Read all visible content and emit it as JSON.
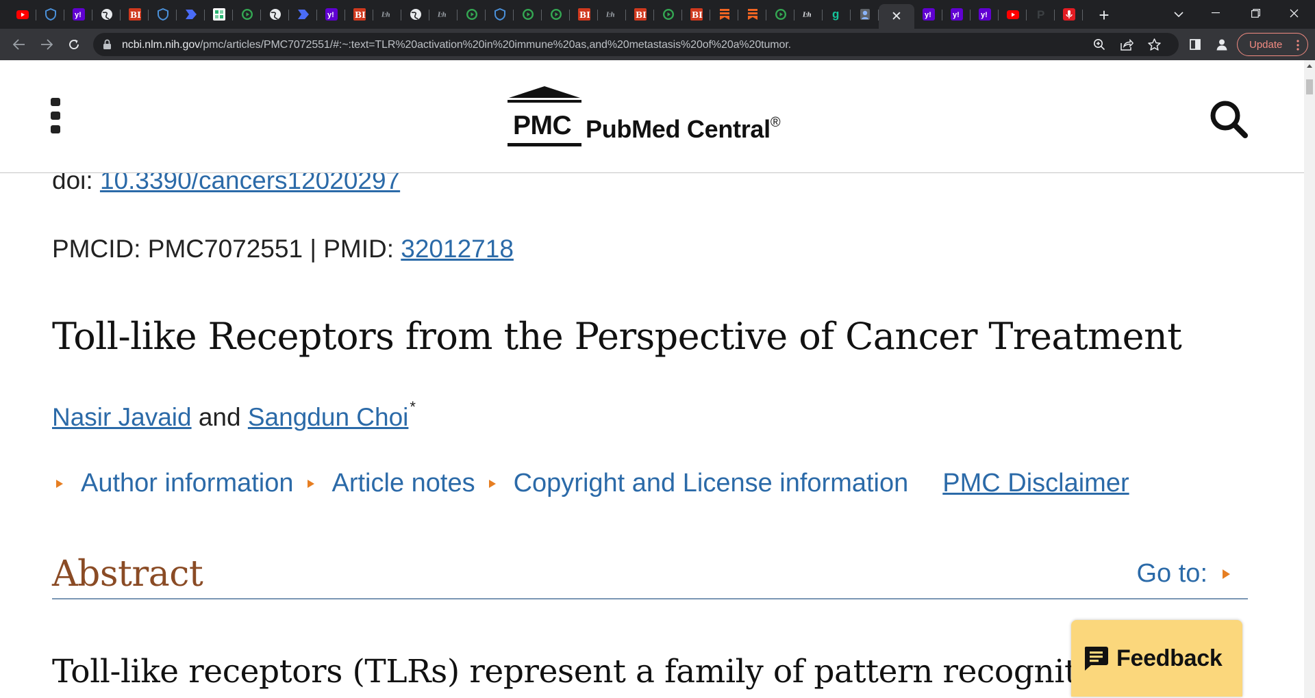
{
  "browser": {
    "tabs": [
      {
        "icon": "youtube-icon",
        "color": "#ff0000"
      },
      {
        "icon": "shield-icon",
        "color": "#4a90d9"
      },
      {
        "icon": "yahoo-icon",
        "color": "#6001d2"
      },
      {
        "icon": "globe-icon",
        "color": "#e8eaed"
      },
      {
        "icon": "business-insider-icon",
        "color": "#d0391e"
      },
      {
        "icon": "shield-icon",
        "color": "#4a90d9"
      },
      {
        "icon": "arrow-tag-icon",
        "color": "#4a6cf7"
      },
      {
        "icon": "puzzle-icon",
        "color": "#2bb673"
      },
      {
        "icon": "play-circle-icon",
        "color": "#34a853"
      },
      {
        "icon": "globe-icon",
        "color": "#e8eaed"
      },
      {
        "icon": "arrow-tag-icon",
        "color": "#4a6cf7"
      },
      {
        "icon": "yahoo-icon",
        "color": "#6001d2"
      },
      {
        "icon": "business-insider-icon",
        "color": "#d0391e"
      },
      {
        "icon": "wordmark-icon",
        "color": "#9aa0a6"
      },
      {
        "icon": "globe-icon",
        "color": "#e8eaed"
      },
      {
        "icon": "wordmark-icon",
        "color": "#9aa0a6"
      },
      {
        "icon": "play-circle-icon",
        "color": "#34a853"
      },
      {
        "icon": "shield-icon",
        "color": "#4a90d9"
      },
      {
        "icon": "play-circle-icon",
        "color": "#34a853"
      },
      {
        "icon": "play-circle-icon",
        "color": "#34a853"
      },
      {
        "icon": "business-insider-icon",
        "color": "#d0391e"
      },
      {
        "icon": "wordmark-icon",
        "color": "#9aa0a6"
      },
      {
        "icon": "business-insider-icon",
        "color": "#d0391e"
      },
      {
        "icon": "play-circle-icon",
        "color": "#34a853"
      },
      {
        "icon": "business-insider-icon",
        "color": "#d0391e"
      },
      {
        "icon": "bookmark-ribbon-icon",
        "color": "#f26522"
      },
      {
        "icon": "bookmark-ribbon-icon",
        "color": "#f26522"
      },
      {
        "icon": "play-circle-icon",
        "color": "#34a853"
      },
      {
        "icon": "wordmark-icon",
        "color": "#dadce0"
      },
      {
        "icon": "grammarly-icon",
        "color": "#15c39a"
      },
      {
        "icon": "portrait-icon",
        "color": "#8ab4f8"
      },
      {
        "icon": "close-icon",
        "color": "#e8eaed",
        "active": true
      },
      {
        "icon": "yahoo-icon",
        "color": "#6001d2"
      },
      {
        "icon": "yahoo-icon",
        "color": "#6001d2"
      },
      {
        "icon": "yahoo-icon",
        "color": "#6001d2"
      },
      {
        "icon": "youtube-icon",
        "color": "#ff0000"
      },
      {
        "icon": "letter-p-icon",
        "color": "#3c4043"
      },
      {
        "icon": "microphone-icon",
        "color": "#e31c23"
      }
    ],
    "url_host": "ncbi.nlm.nih.gov",
    "url_path": "/pmc/articles/PMC7072551/#:~:text=TLR%20activation%20in%20immune%20as,and%20metastasis%20of%20a%20tumor.",
    "update_label": "Update",
    "accent_color": "#f28b82"
  },
  "site": {
    "logo_abbrev": "PMC",
    "logo_name": "PubMed Central",
    "logo_reg": "®"
  },
  "article": {
    "doi_prefix": "doi: ",
    "doi_value": "10.3390/cancers12020297",
    "pmcid_label": "PMCID: PMC7072551 | PMID: ",
    "pmid_value": "32012718",
    "title": "Toll-like Receptors from the Perspective of Cancer Treatment",
    "author_1": "Nasir Javaid",
    "author_joiner": "and",
    "author_2": "Sangdun Choi",
    "author_2_mark": "*",
    "links": {
      "author_information": "Author information",
      "article_notes": "Article notes",
      "copyright": "Copyright and License information",
      "disclaimer": "PMC Disclaimer"
    },
    "abstract_heading": "Abstract",
    "goto_label": "Go to:",
    "abstract_start": "Toll-like receptors (TLRs) represent a family of pattern recognition rec"
  },
  "feedback": {
    "label": "Feedback",
    "color": "#fbd77c"
  },
  "colors": {
    "link": "#2b6aa8",
    "heading_brown": "#8a4b25",
    "toggle_arrow": "#e67e22"
  }
}
